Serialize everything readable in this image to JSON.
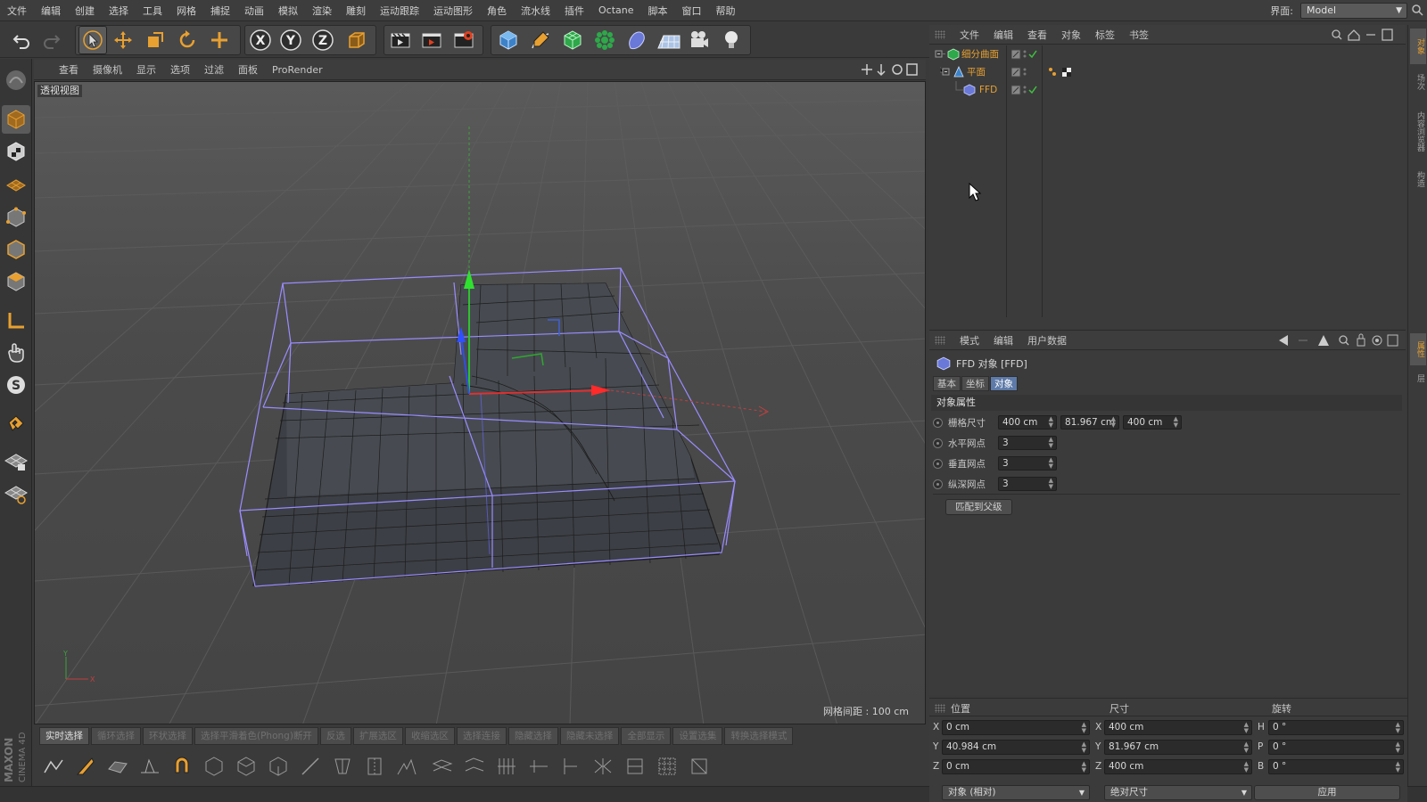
{
  "menubar": {
    "items": [
      "文件",
      "编辑",
      "创建",
      "选择",
      "工具",
      "网格",
      "捕捉",
      "动画",
      "模拟",
      "渲染",
      "雕刻",
      "运动跟踪",
      "运动图形",
      "角色",
      "流水线",
      "插件",
      "Octane",
      "脚本",
      "窗口",
      "帮助"
    ],
    "layout_label": "界面:",
    "layout_value": "Model"
  },
  "toolbar": {
    "icons": [
      "undo-icon",
      "redo-icon",
      "live-selection-icon",
      "move-icon",
      "scale-icon",
      "rotate-icon",
      "recent-tool-icon",
      "x-axis-lock-icon",
      "y-axis-lock-icon",
      "z-axis-lock-icon",
      "coordinate-system-icon",
      "render-view-icon",
      "render-picture-viewer-icon",
      "render-settings-icon",
      "cube-icon",
      "pen-icon",
      "subdivision-icon",
      "cloner-icon",
      "deformer-icon",
      "floor-icon",
      "camera-icon",
      "light-icon"
    ],
    "axis_x": "X",
    "axis_y": "Y",
    "axis_z": "Z"
  },
  "viewport": {
    "menu": [
      "查看",
      "摄像机",
      "显示",
      "选项",
      "过滤",
      "面板",
      "ProRender"
    ],
    "view_label": "透视视图",
    "grid_spacing": "网格间距 : 100 cm"
  },
  "bottom_tabs": [
    "实时选择",
    "循环选择",
    "环状选择",
    "选择平滑着色(Phong)断开",
    "反选",
    "扩展选区",
    "收缩选区",
    "选择连接",
    "隐藏选择",
    "隐藏未选择",
    "全部显示",
    "设置选集",
    "转换选择模式"
  ],
  "objects": {
    "menu": [
      "文件",
      "编辑",
      "查看",
      "对象",
      "标签",
      "书签"
    ],
    "tree": [
      {
        "name": "细分曲面",
        "color": "#e8a030",
        "level": 0
      },
      {
        "name": "平面",
        "color": "#e8a030",
        "level": 1
      },
      {
        "name": "FFD",
        "color": "#e8a030",
        "level": 2
      }
    ]
  },
  "side_tabs": [
    "对象",
    "场次",
    "内容浏览器",
    "构造",
    "属性",
    "层"
  ],
  "attributes": {
    "menu": [
      "模式",
      "编辑",
      "用户数据"
    ],
    "title": "FFD 对象 [FFD]",
    "tabs": [
      "基本",
      "坐标",
      "对象"
    ],
    "active_tab": "对象",
    "section": "对象属性",
    "props": [
      {
        "label": "栅格尺寸",
        "values": [
          "400 cm",
          "81.967 cm",
          "400 cm"
        ]
      },
      {
        "label": "水平网点",
        "values": [
          "3"
        ]
      },
      {
        "label": "垂直网点",
        "values": [
          "3"
        ]
      },
      {
        "label": "纵深网点",
        "values": [
          "3"
        ]
      }
    ],
    "fit_button": "匹配到父级"
  },
  "coordinates": {
    "headers": [
      "位置",
      "尺寸",
      "旋转"
    ],
    "rows": [
      {
        "a1": "X",
        "v1": "0 cm",
        "a2": "X",
        "v2": "400 cm",
        "a3": "H",
        "v3": "0 °"
      },
      {
        "a1": "Y",
        "v1": "40.984 cm",
        "a2": "Y",
        "v2": "81.967 cm",
        "a3": "P",
        "v3": "0 °"
      },
      {
        "a1": "Z",
        "v1": "0 cm",
        "a2": "Z",
        "v2": "400 cm",
        "a3": "B",
        "v3": "0 °"
      }
    ],
    "mode_select": "对象 (相对)",
    "size_select": "绝对尺寸",
    "apply": "应用"
  },
  "colors": {
    "accent": "#e8a030",
    "selection": "#5d7aa8",
    "ffd_cage": "#9a8cff",
    "axis_x": "#e03030",
    "axis_y": "#30c030",
    "axis_z": "#3050e0"
  }
}
